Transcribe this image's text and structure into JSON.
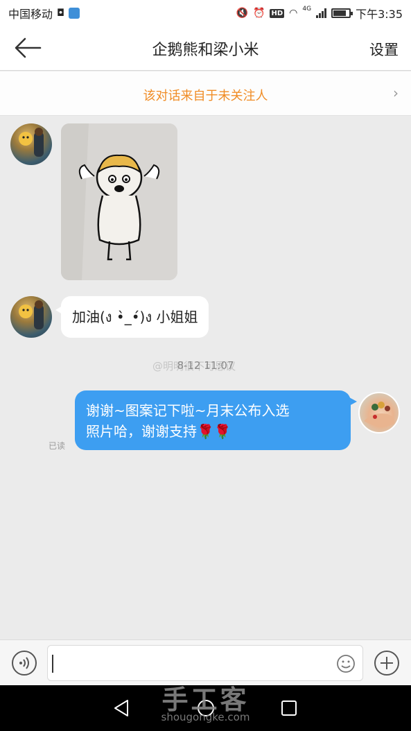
{
  "status_bar": {
    "carrier": "中国移动",
    "network": "4G",
    "time": "下午3:35",
    "battery_level": 0.8
  },
  "nav": {
    "title": "企鹅熊和梁小米",
    "settings_label": "设置"
  },
  "notice": {
    "text": "该对话来自于未关注人"
  },
  "messages": {
    "incoming_text": "加油(ง •̀_•́)ง 小姐姐",
    "timestamp": "8-12 11:07",
    "outgoing_line1": "谢谢~图案记下啦~月末公布入选",
    "outgoing_line2": "照片哈，谢谢支持",
    "roses": "🌹🌹",
    "read_status": "已读"
  },
  "watermarks": {
    "weibo": "@明明很不可思议",
    "site_cn": "手工客",
    "site_url": "shougongke.com"
  },
  "colors": {
    "accent_blue": "#3d9ef1",
    "notice_orange": "#f08c25"
  },
  "icons": [
    "back-arrow-icon",
    "chevron-right-icon",
    "voice-icon",
    "emoji-icon",
    "plus-icon",
    "nav-back-icon",
    "nav-home-icon",
    "nav-recents-icon"
  ]
}
